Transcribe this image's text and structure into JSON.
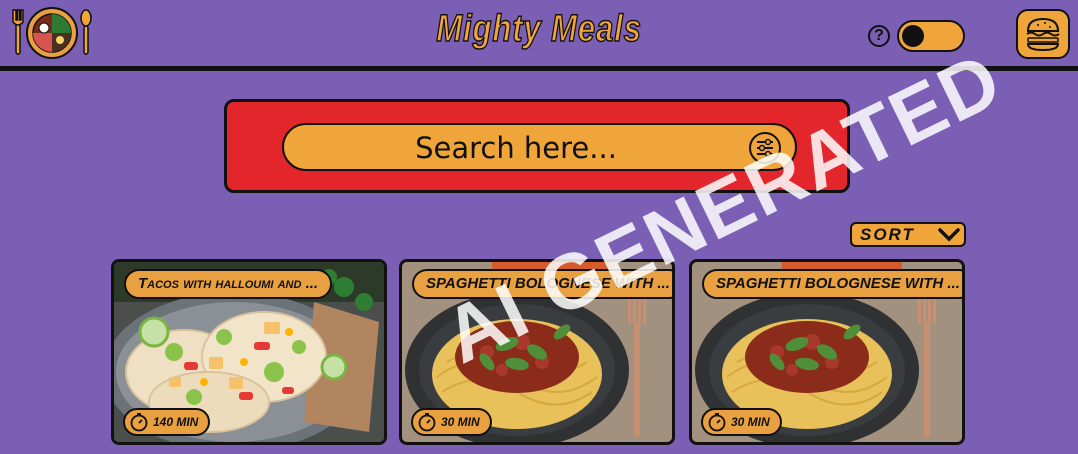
{
  "header": {
    "brand": "Mighty Meals",
    "help_label": "?"
  },
  "search": {
    "placeholder": "Search here..."
  },
  "sort": {
    "label": "SORT"
  },
  "cards": [
    {
      "title": "Tacos with halloumi and ...",
      "time": "140 MIN",
      "food": "tacos"
    },
    {
      "title": "SPAGHETTI BOLOGNESE WITH ...",
      "time": "30 MIN",
      "food": "spaghetti"
    },
    {
      "title": "SPAGHETTI BOLOGNESE WITH ...",
      "time": "30 MIN",
      "food": "spaghetti"
    }
  ],
  "watermark": "AI GENERATED",
  "colors": {
    "background": "#7b5fb5",
    "accent": "#f0a53a",
    "search_panel": "#e3262b"
  }
}
